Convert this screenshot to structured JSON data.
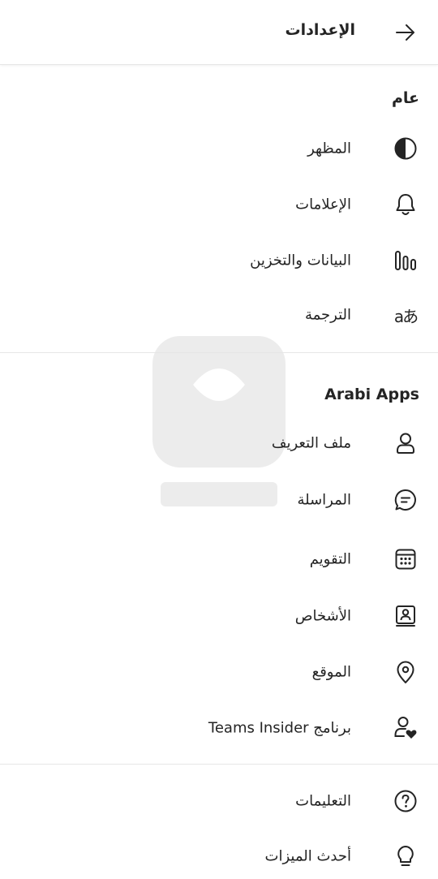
{
  "header": {
    "title": "الإعدادات",
    "back_icon": "arrow-right-icon"
  },
  "general": {
    "title": "عام",
    "items": [
      {
        "label": "المظهر",
        "icon": "contrast-icon"
      },
      {
        "label": "الإعلامات",
        "icon": "bell-icon"
      },
      {
        "label": "البيانات والتخزين",
        "icon": "data-bars-icon"
      },
      {
        "label": "الترجمة",
        "icon": "translate-icon",
        "glyph": "aあ"
      }
    ]
  },
  "apps": {
    "title": "Arabi Apps",
    "items": [
      {
        "label": "ملف التعريف",
        "icon": "person-icon"
      },
      {
        "label": "المراسلة",
        "icon": "chat-icon"
      },
      {
        "label": "التقويم",
        "icon": "calendar-icon"
      },
      {
        "label": "الأشخاص",
        "icon": "contacts-icon"
      },
      {
        "label": "الموقع",
        "icon": "location-pin-icon"
      },
      {
        "label": "برنامج Teams Insider",
        "icon": "person-heart-icon"
      }
    ]
  },
  "help": {
    "items": [
      {
        "label": "التعليمات",
        "icon": "help-icon"
      },
      {
        "label": "أحدث الميزات",
        "icon": "lightbulb-icon"
      }
    ]
  }
}
